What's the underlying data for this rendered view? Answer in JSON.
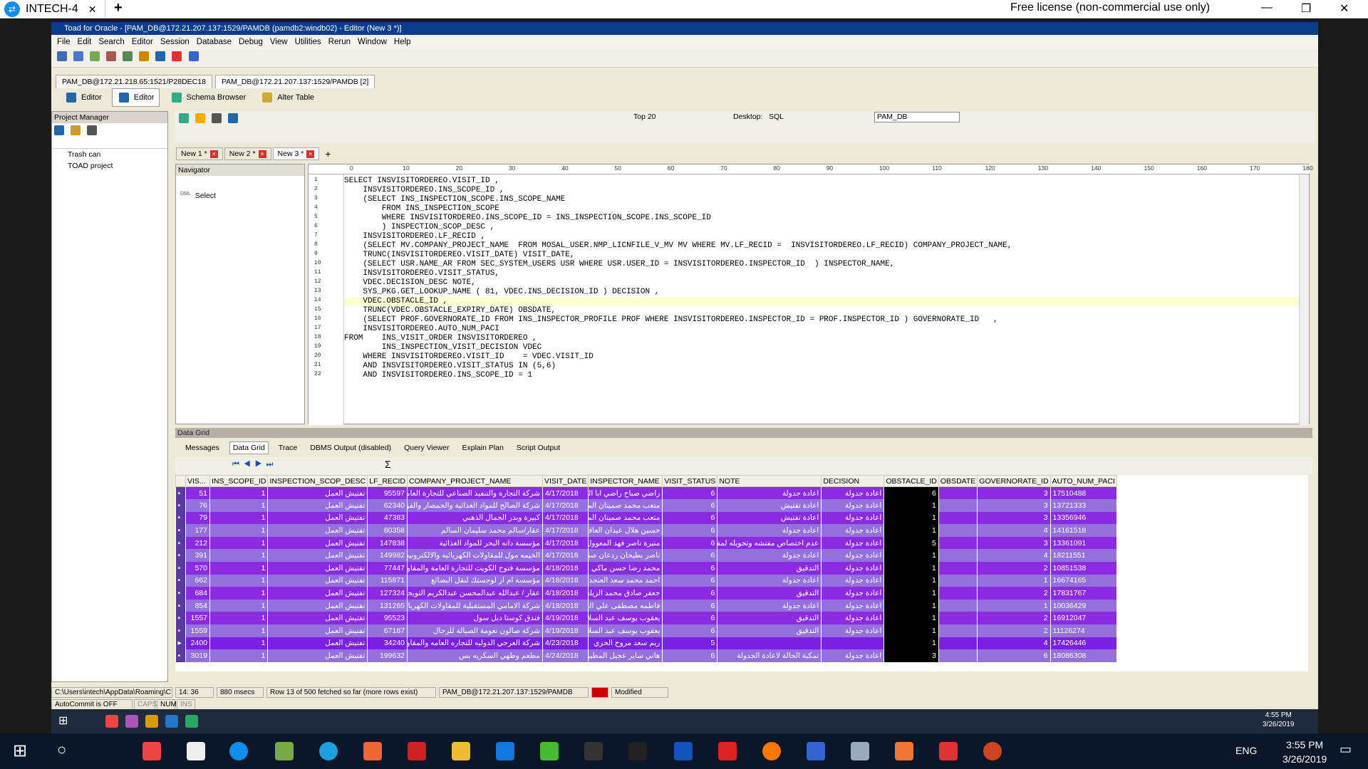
{
  "teamviewer": {
    "tab_title": "INTECH-4",
    "close_glyph": "✕",
    "add_glyph": "+",
    "license": "Free license (non-commercial use only)"
  },
  "toad": {
    "title": "Toad for Oracle - [PAM_DB@172.21.207.137:1529/PAMDB (pamdb2:windb02) - Editor (New 3 *)]",
    "menu": [
      "File",
      "Edit",
      "Search",
      "Editor",
      "Session",
      "Database",
      "Debug",
      "View",
      "Utilities",
      "Rerun",
      "Window",
      "Help"
    ],
    "connections": [
      "PAM_DB@172.21.218.65:1521/P28DEC18",
      "PAM_DB@172.21.207.137:1529/PAMDB [2]"
    ],
    "subtabs": [
      "Editor",
      "Editor",
      "Schema Browser",
      "Alter Table"
    ],
    "project_manager": {
      "title": "Project Manager",
      "items": [
        "Trash can",
        "TOAD project"
      ]
    },
    "toolbar": {
      "top_n": "Top 20",
      "desktop_label": "Desktop:",
      "desktop_value": "SQL",
      "connection": "PAM_DB"
    },
    "doc_tabs": [
      "New 1 *",
      "New 2 *",
      "New 3 *"
    ],
    "navigator": {
      "title": "Navigator",
      "item": "Select",
      "item_tag": "DML"
    },
    "ruler": [
      "0",
      "10",
      "20",
      "30",
      "40",
      "50",
      "60",
      "70",
      "80",
      "90",
      "100",
      "110",
      "120",
      "130",
      "140",
      "150",
      "160",
      "170",
      "180"
    ],
    "code": [
      "SELECT INSVISITORDEREO.VISIT_ID ,",
      "    INSVISITORDEREO.INS_SCOPE_ID ,",
      "    (SELECT INS_INSPECTION_SCOPE.INS_SCOPE_NAME",
      "        FROM INS_INSPECTION_SCOPE",
      "        WHERE INSVISITORDEREO.INS_SCOPE_ID = INS_INSPECTION_SCOPE.INS_SCOPE_ID",
      "        ) INSPECTION_SCOP_DESC ,",
      "    INSVISITORDEREO.LF_RECID ,",
      "    (SELECT MV.COMPANY_PROJECT_NAME  FROM MOSAL_USER.NMP_LICNFILE_V_MV MV WHERE MV.LF_RECID =  INSVISITORDEREO.LF_RECID) COMPANY_PROJECT_NAME,",
      "    TRUNC(INSVISITORDEREO.VISIT_DATE) VISIT_DATE,",
      "    (SELECT USR.NAME_AR FROM SEC_SYSTEM_USERS USR WHERE USR.USER_ID = INSVISITORDEREO.INSPECTOR_ID  ) INSPECTOR_NAME,",
      "    INSVISITORDEREO.VISIT_STATUS,",
      "    VDEC.DECISION_DESC NOTE,",
      "    SYS_PKG.GET_LOOKUP_NAME ( 81, VDEC.INS_DECISION_ID ) DECISION ,",
      "    VDEC.OBSTACLE_ID ,",
      "    TRUNC(VDEC.OBSTACLE_EXPIRY_DATE) OBSDATE,",
      "    (SELECT PROF.GOVERNORATE_ID FROM INS_INSPECTOR_PROFILE PROF WHERE INSVISITORDEREO.INSPECTOR_ID = PROF.INSPECTOR_ID ) GOVERNORATE_ID   ,",
      "    INSVISITORDEREO.AUTO_NUM_PACI",
      "FROM    INS_VISIT_ORDER INSVISITORDEREO ,",
      "        INS_INSPECTION_VISIT_DECISION VDEC",
      "    WHERE INSVISITORDEREO.VISIT_ID    = VDEC.VISIT_ID",
      "    AND INSVISITORDEREO.VISIT_STATUS IN (5,6)",
      "    AND INSVISITORDEREO.INS_SCOPE_ID = 1"
    ],
    "data_grid": {
      "title": "Data Grid",
      "tabs": [
        "Messages",
        "Data Grid",
        "Trace",
        "DBMS Output (disabled)",
        "Query Viewer",
        "Explain Plan",
        "Script Output"
      ],
      "columns": [
        "VIS...",
        "INS_SCOPE_ID",
        "INSPECTION_SCOP_DESC",
        "LF_RECID",
        "COMPANY_PROJECT_NAME",
        "VISIT_DATE",
        "INSPECTOR_NAME",
        "VISIT_STATUS",
        "NOTE",
        "DECISION",
        "OBSTACLE_ID",
        "OBSDATE",
        "GOVERNORATE_ID",
        "AUTO_NUM_PACI"
      ],
      "rows": [
        [
          "51",
          "1",
          "تفتيش العمل",
          "95597",
          "شركة التجارة والتنفيذ الصناعي للتجارة العامة والمقاولات",
          "4/17/2018",
          "راضي صباح راضي ابا الخيل",
          "6",
          "اعادة جدولة",
          "اعادة جدولة",
          "6",
          "",
          "3",
          "17510488"
        ],
        [
          "76",
          "1",
          "تفتيش العمل",
          "62340",
          "شركة الصالح للمواد الغذائية والحمصار والفواكه",
          "4/17/2018",
          "متعب محمد صميتان المطيري",
          "6",
          "اعادة تفتيش",
          "اعادة جدولة",
          "1",
          "",
          "3",
          "13721333"
        ],
        [
          "79",
          "1",
          "تفتيش العمل",
          "47383",
          "كبيرة وبدر الجمال الذهبي",
          "4/17/2018",
          "متعب محمد صميتان المطيري",
          "6",
          "اعادة تفتيش",
          "اعادة جدولة",
          "1",
          "",
          "3",
          "13356946"
        ],
        [
          "177",
          "1",
          "تفتيش العمل",
          "80358",
          "عقار/سالم محمد سليمان السالم",
          "4/17/2018",
          "حسين هلال عيدان العاقدي",
          "6",
          "اعادة جدولة",
          "اعادة جدولة",
          "1",
          "",
          "4",
          "14161518"
        ],
        [
          "212",
          "1",
          "تفتيش العمل",
          "147838",
          "مؤسسة دانه البحر للمواد الغذائية",
          "4/17/2018",
          "منيرة ناصر فهد المعوول",
          "6",
          "عدم اختصاص مفتشه وتحويله لمفتش",
          "اعادة جدولة",
          "5",
          "",
          "3",
          "13361091"
        ],
        [
          "391",
          "1",
          "تفتيش العمل",
          "149982",
          "الخيمه مول للمقاولات الكهربائيه والالكترونيه",
          "4/17/2018",
          "ناصر بطيحان ردعان صقر",
          "6",
          "اعادة جدولة",
          "اعادة جدولة",
          "1",
          "",
          "4",
          "18211551"
        ],
        [
          "570",
          "1",
          "تفتيش العمل",
          "77447",
          "مؤسسة فتوح الكويت للتجارة العامة والمقاولات",
          "4/18/2018",
          "محمد رضا حسن ماكي",
          "6",
          "التدقيق",
          "اعادة جدولة",
          "1",
          "",
          "2",
          "10851538"
        ],
        [
          "662",
          "1",
          "تفتيش العمل",
          "115871",
          "مؤسسة ام ار لوجستك لنقل البضائع",
          "4/18/2018",
          "احمد محمد سعد العنجدي",
          "6",
          "اعادة جدولة",
          "اعادة جدولة",
          "1",
          "",
          "1",
          "16674165"
        ],
        [
          "684",
          "1",
          "تفتيش العمل",
          "127324",
          "عقار / عبدالله عبدالمحسن عبدالكريم التويجري",
          "4/18/2018",
          "جعفر صادق محمد الزيلعه",
          "6",
          "التدقيق",
          "اعادة جدولة",
          "1",
          "",
          "2",
          "17831767"
        ],
        [
          "854",
          "1",
          "تفتيش العمل",
          "131265",
          "شركة الامامي المستقبلية للمقاولات الكهربائية",
          "4/18/2018",
          "فاطمه مصطفى علي الفطني",
          "6",
          "اعادة جدولة",
          "اعادة جدولة",
          "1",
          "",
          "1",
          "10036429"
        ],
        [
          "1557",
          "1",
          "تفتيش العمل",
          "95523",
          "فندق كوستا دبل سول",
          "4/19/2018",
          "يعقوب يوسف عبد السلام مصطفى",
          "6",
          "التدقيق",
          "اعادة جدولة",
          "1",
          "",
          "2",
          "16912047"
        ],
        [
          "1559",
          "1",
          "تفتيش العمل",
          "67187",
          "شركة صالون نعومة الصبالة للرجال",
          "4/19/2018",
          "يعقوب يوسف عبد السلام مصطفى",
          "6",
          "التدقيق",
          "اعادة جدولة",
          "1",
          "",
          "2",
          "11126274"
        ],
        [
          "2400",
          "1",
          "تفتيش العمل",
          "34240",
          "شركة العرجي الدوليه للتجاره العامه والمقاولات",
          "4/23/2018",
          "ريم سعد مروح الحزي",
          "5",
          "",
          "",
          "1",
          "",
          "4",
          "17426446"
        ],
        [
          "3019",
          "1",
          "تفتيش العمل",
          "199632",
          "مطعم وطهي السكريه بس",
          "4/24/2018",
          "هاني ساير عجيل المطيري",
          "6",
          "تمكبة الحالة لاعادة الجدولة",
          "اعادة جدولة",
          "3",
          "",
          "6",
          "18086308"
        ]
      ]
    },
    "status": {
      "path": "C:\\Users\\intech\\AppData\\Roaming\\C",
      "position": "14: 36",
      "time": "880 msecs",
      "rows": "Row 13 of 500 fetched so far (more rows exist)",
      "connection": "PAM_DB@172.21.207.137:1529/PAMDB",
      "modified": "Modified",
      "autocommit": "AutoCommit is OFF",
      "caps": "CAPS",
      "num": "NUM",
      "ins": "INS"
    }
  },
  "remote_taskbar": {
    "time": "4:55 PM",
    "date": "3/26/2019"
  },
  "local_taskbar": {
    "lang": "ENG",
    "time": "3:55 PM",
    "date": "3/26/2019"
  }
}
